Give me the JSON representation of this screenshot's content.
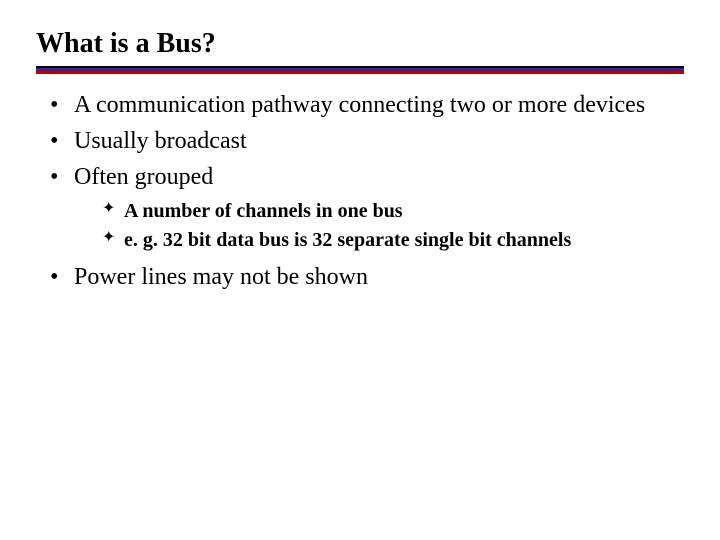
{
  "title": "What is a Bus?",
  "bullets": {
    "b0": "A communication pathway connecting two or more devices",
    "b1": "Usually broadcast",
    "b2": "Often grouped",
    "b2_sub": {
      "s0": "A number of channels in one bus",
      "s1": "e. g. 32 bit data bus is 32 separate single bit channels"
    },
    "b3": "Power lines may not be shown"
  }
}
